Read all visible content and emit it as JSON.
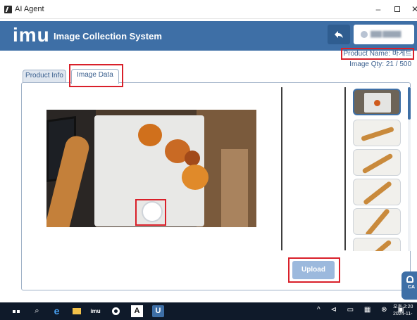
{
  "window": {
    "title": "AI Agent",
    "minimize": "–",
    "close": "✕"
  },
  "header": {
    "logo": "imu",
    "title": "Image Collection System",
    "user": "███ █████"
  },
  "product": {
    "name_label": "Product Name: 바게트",
    "qty_label": "Image Qty: 21 / 500"
  },
  "tabs": [
    {
      "label": "Product Info",
      "active": false
    },
    {
      "label": "Image Data",
      "active": true
    }
  ],
  "upload": {
    "label": "Upload"
  },
  "side_badge": {
    "label": "CA"
  },
  "thumbnails": {
    "count_visible": 6,
    "selected_index": 0
  },
  "taskbar": {
    "imu_label": "imu",
    "agent_label": "A",
    "u_label": "U",
    "search_icon": "⌕",
    "ie_icon": "e",
    "tray": "^ ⊲ ▭ ▦ ⊗ ▣",
    "time": "오후 2:20",
    "date": "2024-11-"
  },
  "icons": {
    "back": "back-arrow-icon",
    "shutter": "shutter-icon"
  },
  "colors": {
    "header_bg": "#3e6fa6",
    "highlight": "#d9202a",
    "upload_bg": "#9cb9dd"
  }
}
